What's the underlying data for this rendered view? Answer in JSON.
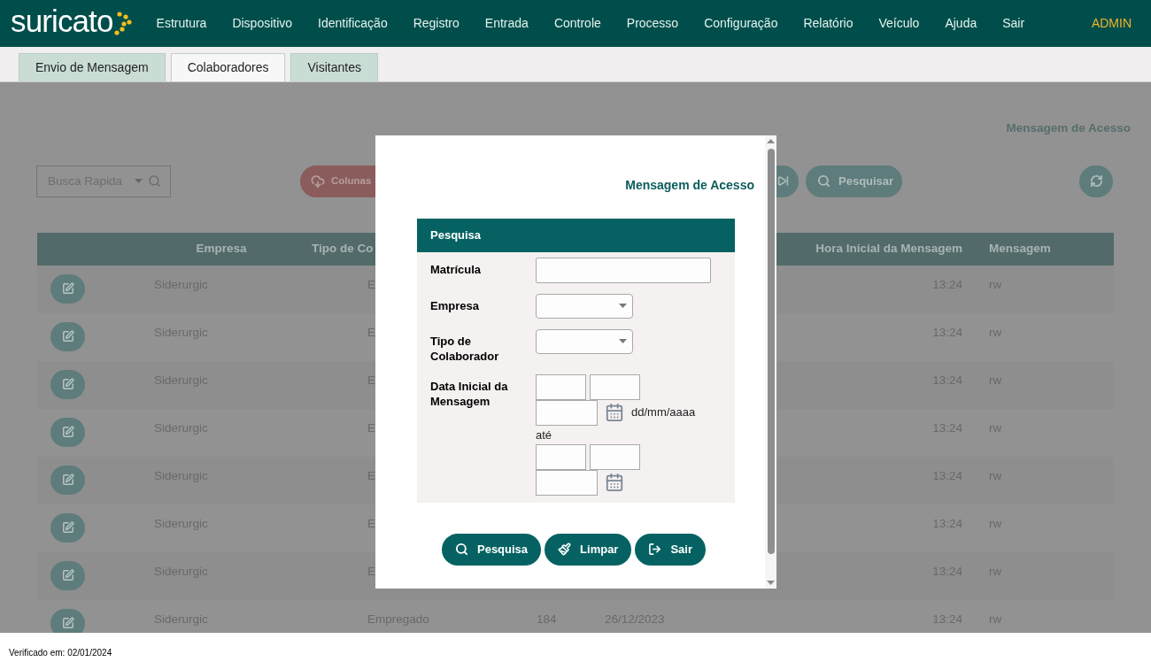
{
  "header": {
    "logo": "suricato",
    "menu": [
      "Estrutura",
      "Dispositivo",
      "Identificação",
      "Registro",
      "Entrada",
      "Controle",
      "Processo",
      "Configuração",
      "Relatório",
      "Veículo",
      "Ajuda",
      "Sair"
    ],
    "user": "ADMIN"
  },
  "tabs": [
    {
      "label": "Envio de Mensagem",
      "selected": false
    },
    {
      "label": "Colaboradores",
      "selected": true
    },
    {
      "label": "Visitantes",
      "selected": false
    }
  ],
  "page": {
    "title": "Mensagem de Acesso",
    "toolbar": {
      "search_placeholder": "Busca Rapida",
      "columns_button": "Colunas",
      "search_button": "Pesquisar"
    },
    "table": {
      "columns": {
        "empresa": "Empresa",
        "tipo": "Tipo de Co",
        "hora": "Hora Inicial da Mensagem",
        "mensagem": "Mensagem"
      },
      "rows": [
        {
          "empresa": "Siderurgic",
          "tipo": "E",
          "hora": "13:24",
          "mensagem": "rw"
        },
        {
          "empresa": "Siderurgic",
          "tipo": "E",
          "hora": "13:24",
          "mensagem": "rw"
        },
        {
          "empresa": "Siderurgic",
          "tipo": "E",
          "hora": "13:24",
          "mensagem": "rw"
        },
        {
          "empresa": "Siderurgic",
          "tipo": "E",
          "hora": "13:24",
          "mensagem": "rw"
        },
        {
          "empresa": "Siderurgic",
          "tipo": "E",
          "hora": "13:24",
          "mensagem": "rw"
        },
        {
          "empresa": "Siderurgic",
          "tipo": "E",
          "hora": "13:24",
          "mensagem": "rw"
        },
        {
          "empresa": "Siderurgic",
          "tipo": "E",
          "hora": "13:24",
          "mensagem": "rw"
        },
        {
          "empresa": "Siderurgic",
          "tipo": "Empregado",
          "column_4": "184",
          "column_5": "26/12/2023",
          "hora": "13:24",
          "mensagem": "rw"
        }
      ]
    }
  },
  "dialog": {
    "title": "Mensagem de Acesso",
    "panel_title": "Pesquisa",
    "fields": [
      {
        "label": "Matrícula",
        "kind": "text"
      },
      {
        "label": "Empresa",
        "kind": "select"
      },
      {
        "label": "Tipo de Colaborador",
        "kind": "select"
      },
      {
        "label": "Data Inicial da Mensagem",
        "kind": "date_range",
        "hint": "dd/mm/aaaa",
        "separator": "até"
      }
    ],
    "buttons": [
      {
        "label": "Pesquisa",
        "kind": "search"
      },
      {
        "label": "Limpar",
        "kind": "clear"
      },
      {
        "label": "Sair",
        "kind": "exit"
      }
    ]
  },
  "footer": "Verificado em: 02/01/2024"
}
